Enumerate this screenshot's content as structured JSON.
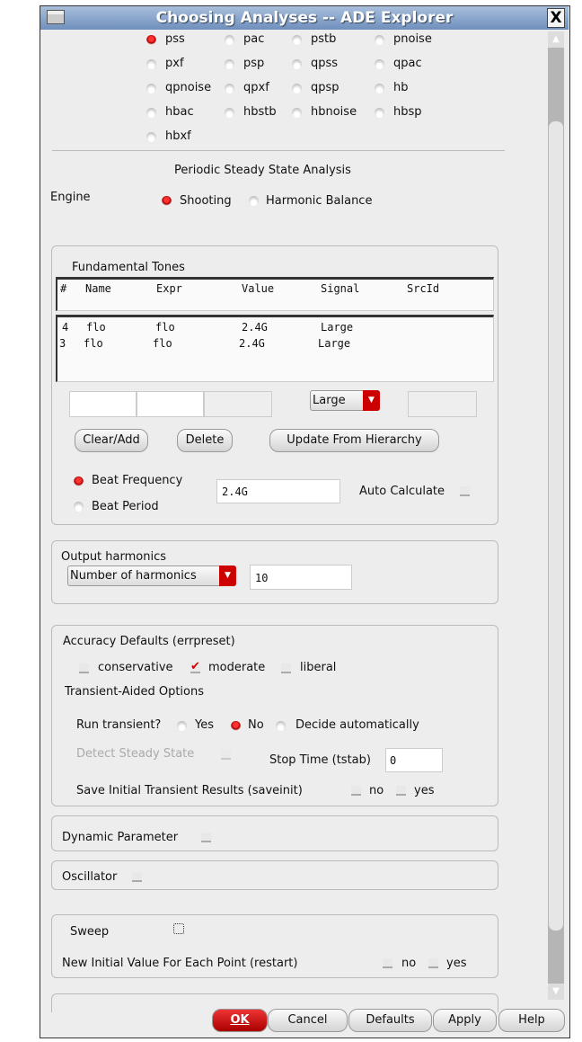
{
  "window": {
    "title": "Choosing Analyses -- ADE Explorer",
    "close": "X"
  },
  "analyses": [
    {
      "label": "pss",
      "selected": true
    },
    {
      "label": "pac"
    },
    {
      "label": "pstb"
    },
    {
      "label": "pnoise"
    },
    {
      "label": "pxf"
    },
    {
      "label": "psp"
    },
    {
      "label": "qpss"
    },
    {
      "label": "qpac"
    },
    {
      "label": "qpnoise"
    },
    {
      "label": "qpxf"
    },
    {
      "label": "qpsp"
    },
    {
      "label": "hb"
    },
    {
      "label": "hbac"
    },
    {
      "label": "hbstb"
    },
    {
      "label": "hbnoise"
    },
    {
      "label": "hbsp"
    },
    {
      "label": "hbxf"
    }
  ],
  "section_title": "Periodic Steady State Analysis",
  "engine": {
    "label": "Engine",
    "options": [
      "Shooting",
      "Harmonic Balance"
    ],
    "selected": "Shooting"
  },
  "tones": {
    "title": "Fundamental Tones",
    "headers": [
      "#",
      "Name",
      "Expr",
      "Value",
      "Signal",
      "SrcId"
    ],
    "rows": [
      [
        "4",
        "flo",
        "flo",
        "2.4G",
        "Large",
        ""
      ],
      [
        "3",
        "flo",
        "flo",
        "2.4G",
        "Large",
        ""
      ]
    ],
    "signal_select": "Large",
    "buttons": [
      "Clear/Add",
      "Delete",
      "Update From Hierarchy"
    ],
    "beat_frequency": "Beat Frequency",
    "beat_period": "Beat Period",
    "beat_value": "2.4G",
    "auto_calculate": "Auto Calculate"
  },
  "output": {
    "title": "Output harmonics",
    "select": "Number of harmonics",
    "value": "10"
  },
  "accuracy": {
    "title": "Accuracy Defaults (errpreset)",
    "options": [
      "conservative",
      "moderate",
      "liberal"
    ],
    "selected": "moderate",
    "transient_title": "Transient-Aided Options",
    "run_transient": "Run transient?",
    "run_options": [
      "Yes",
      "No",
      "Decide automatically"
    ],
    "run_selected": "No",
    "detect": "Detect Steady State",
    "stop_time": "Stop Time (tstab)",
    "stop_value": "0",
    "saveinit": "Save Initial Transient Results (saveinit)",
    "no": "no",
    "yes": "yes"
  },
  "dynamic": "Dynamic Parameter",
  "oscillator": "Oscillator",
  "sweep": {
    "label": "Sweep",
    "restart": "New Initial Value For Each Point (restart)",
    "no": "no",
    "yes": "yes"
  },
  "footer": {
    "ok": "OK",
    "cancel": "Cancel",
    "defaults": "Defaults",
    "apply": "Apply",
    "help": "Help"
  },
  "colors": {
    "accent": "#cc0000"
  }
}
